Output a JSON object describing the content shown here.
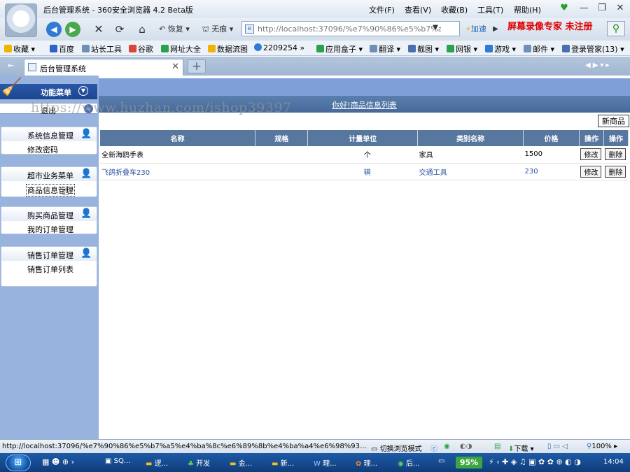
{
  "window": {
    "title": "后台管理系统 - 360安全浏览器 4.2 Beta版",
    "menus": [
      "文件(F)",
      "查看(V)",
      "收藏(B)",
      "工具(T)",
      "帮助(H)"
    ]
  },
  "toolbar": {
    "restore": "恢复",
    "no_trace": "无痕",
    "address": "http://localhost:37096/%e7%90%86%e5%b7%a5",
    "speedup": "加速",
    "watermark": "屏幕录像专家 未注册"
  },
  "favorites": [
    "收藏",
    "百度",
    "站长工具",
    "谷歌",
    "网址大全",
    "数据流图",
    "2209254",
    "应用盒子",
    "翻译",
    "截图",
    "网银",
    "游戏",
    "邮件",
    "登录管家(13)"
  ],
  "tab": {
    "title": "后台管理系统"
  },
  "sidebar": {
    "header": "功能菜单",
    "logout": "退出",
    "groups": [
      {
        "title": "系统信息管理",
        "items": [
          "修改密码"
        ]
      },
      {
        "title": "超市业务菜单",
        "items": [
          "商品信息管理"
        ]
      },
      {
        "title": "购买商品管理",
        "items": [
          "我的订单管理"
        ]
      },
      {
        "title": "销售订单管理",
        "items": [
          "销售订单列表"
        ]
      }
    ]
  },
  "main": {
    "title": "你好!商品信息列表",
    "watermark": "https://www.huzhan.com/ishop39397",
    "new_button": "新商品",
    "columns": [
      "名称",
      "规格",
      "计量单位",
      "类别名称",
      "价格",
      "操作",
      "操作"
    ],
    "rows": [
      {
        "name": "全新海鸥手表",
        "spec": "",
        "unit": "个",
        "category": "家具",
        "price": "1500",
        "edit": "修改",
        "delete": "删除"
      },
      {
        "name": "飞鸽折叠车230",
        "spec": "",
        "unit": "辆",
        "category": "交通工具",
        "price": "230",
        "edit": "修改",
        "delete": "删除"
      }
    ]
  },
  "statusbar": {
    "url": "http://localhost:37096/%e7%90%86%e5%b7%a5%e4%ba%8c%e6%89%8b%e4%ba%a4%e6%98%93...",
    "switch_mode": "切换浏览模式",
    "downloads": "下载",
    "zoom": "100%"
  },
  "taskbar": {
    "tasks": [
      "SQ...",
      "逻...",
      "开发",
      "金...",
      "新...",
      "理...",
      "理...",
      "后..."
    ],
    "battery": "95%",
    "clock": "14:04"
  }
}
